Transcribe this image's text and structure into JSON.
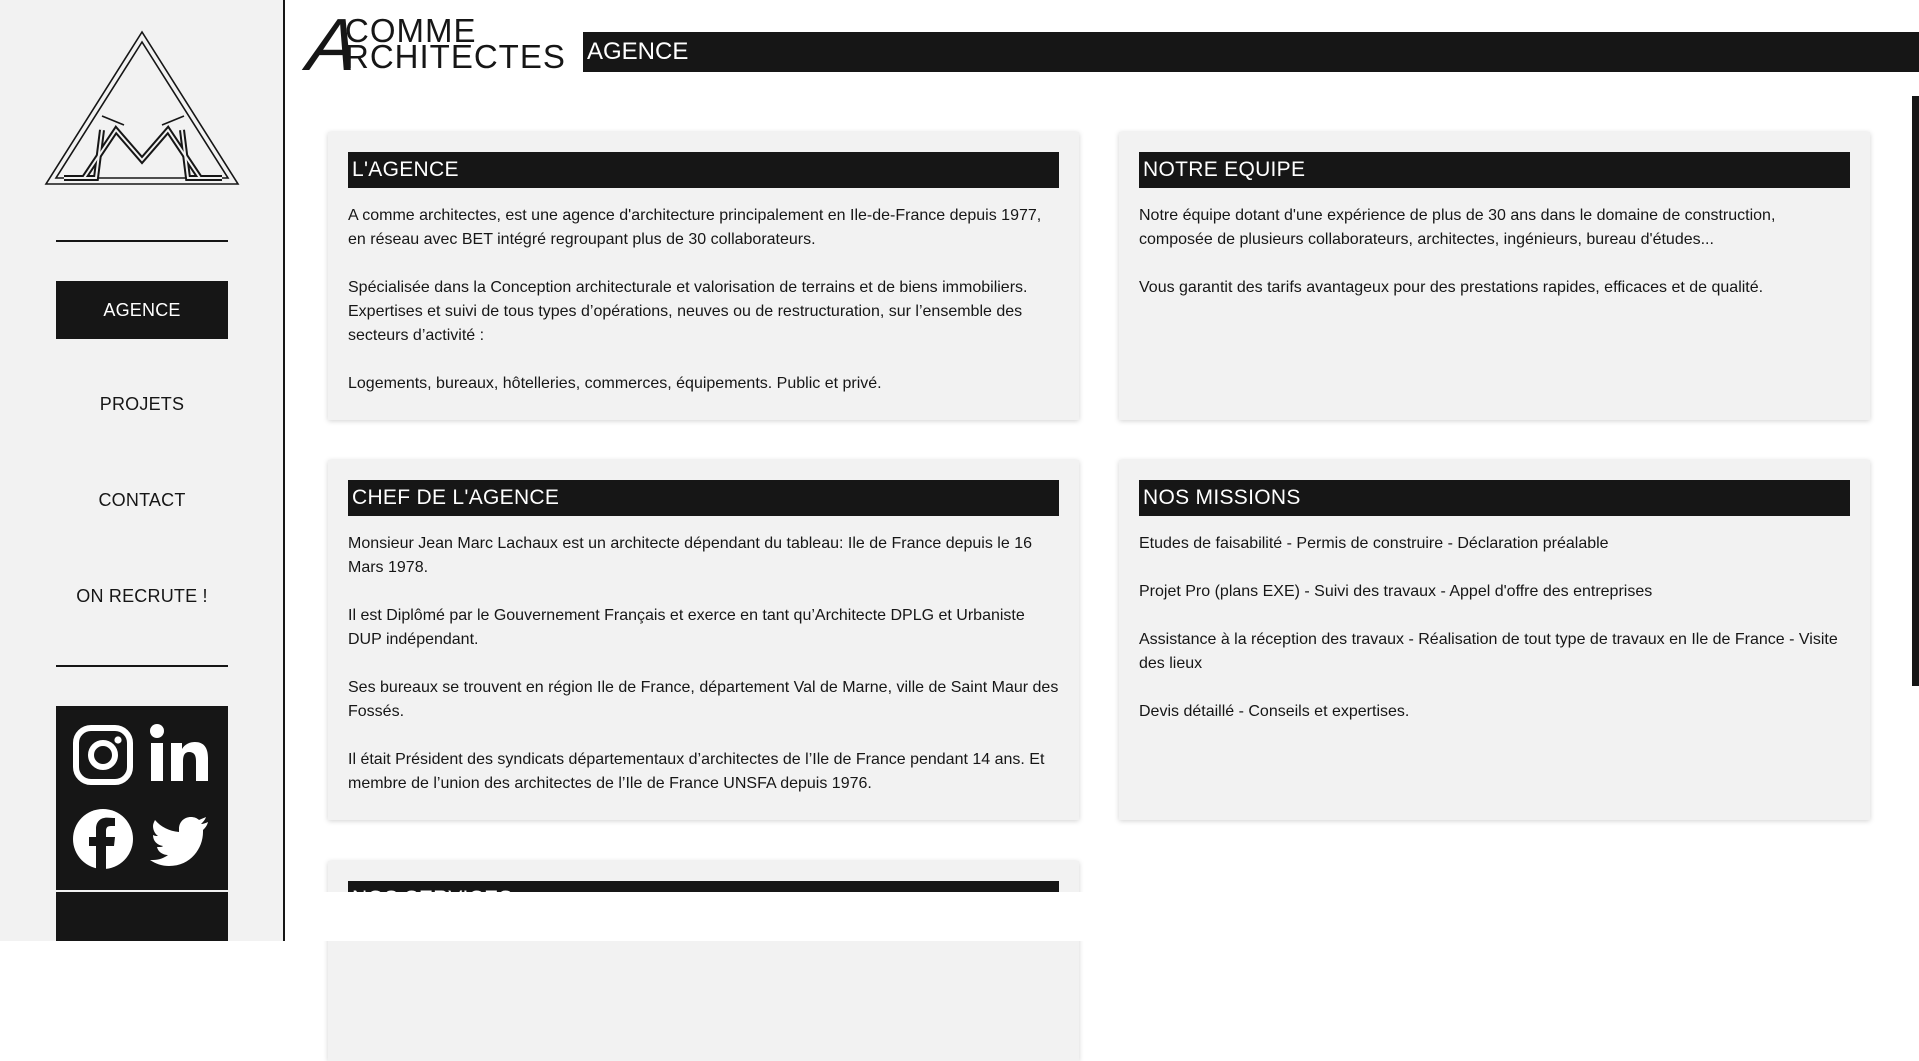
{
  "sidebar": {
    "nav": [
      {
        "label": "AGENCE",
        "active": true
      },
      {
        "label": "PROJETS",
        "active": false
      },
      {
        "label": "CONTACT",
        "active": false
      },
      {
        "label": "ON RECRUTE !",
        "active": false
      }
    ],
    "social_icons": [
      "instagram-icon",
      "linkedin-icon",
      "facebook-icon",
      "twitter-icon"
    ]
  },
  "header": {
    "brand_letter": "A",
    "brand_line1": "COMME",
    "brand_line2": "RCHITECTES",
    "page_title": "AGENCE"
  },
  "cards": {
    "agence": {
      "title": "L'AGENCE",
      "paragraphs": [
        "A comme architectes, est une agence d'architecture principalement en Ile-de-France depuis 1977, en réseau avec BET intégré regroupant plus de 30 collaborateurs.",
        "Spécialisée dans la Conception architecturale et valorisation de terrains et de biens immobiliers. Expertises et suivi de tous types d’opérations, neuves ou de restructuration, sur l’ensemble des secteurs d’activité :",
        "Logements, bureaux, hôtelleries, commerces, équipements. Public et privé."
      ]
    },
    "equipe": {
      "title": "NOTRE EQUIPE",
      "paragraphs": [
        "Notre équipe dotant d'une expérience de plus de 30 ans dans le domaine de construction, composée de plusieurs collaborateurs, architectes, ingénieurs, bureau d'études...",
        "Vous garantit des tarifs avantageux pour des prestations rapides, efficaces et de qualité."
      ]
    },
    "chef": {
      "title": "CHEF DE L'AGENCE",
      "paragraphs": [
        "Monsieur Jean Marc Lachaux est un architecte dépendant du tableau: Ile de France depuis le 16 Mars 1978.",
        "Il est Diplômé par le Gouvernement Français et exerce en tant qu’Architecte DPLG et Urbaniste DUP indépendant.",
        "Ses bureaux se trouvent en région Ile de France, département Val de Marne, ville de Saint Maur des Fossés.",
        "Il était Président des syndicats départementaux d’architectes de l’Ile de France pendant 14 ans. Et membre de l’union des architectes de l’Ile de France UNSFA depuis 1976."
      ]
    },
    "missions": {
      "title": "NOS MISSIONS",
      "paragraphs": [
        "Etudes de faisabilité - Permis de construire - Déclaration préalable",
        "Projet Pro (plans EXE) - Suivi des travaux - Appel d'offre des entreprises",
        "Assistance à la réception des travaux - Réalisation de tout type de travaux en Ile de France - Visite des lieux",
        "Devis détaillé - Conseils et expertises."
      ]
    },
    "services": {
      "title": "NOS SERVICES"
    }
  },
  "colors": {
    "dark": "#161616",
    "panel": "#f2f2f2",
    "white": "#ffffff"
  }
}
